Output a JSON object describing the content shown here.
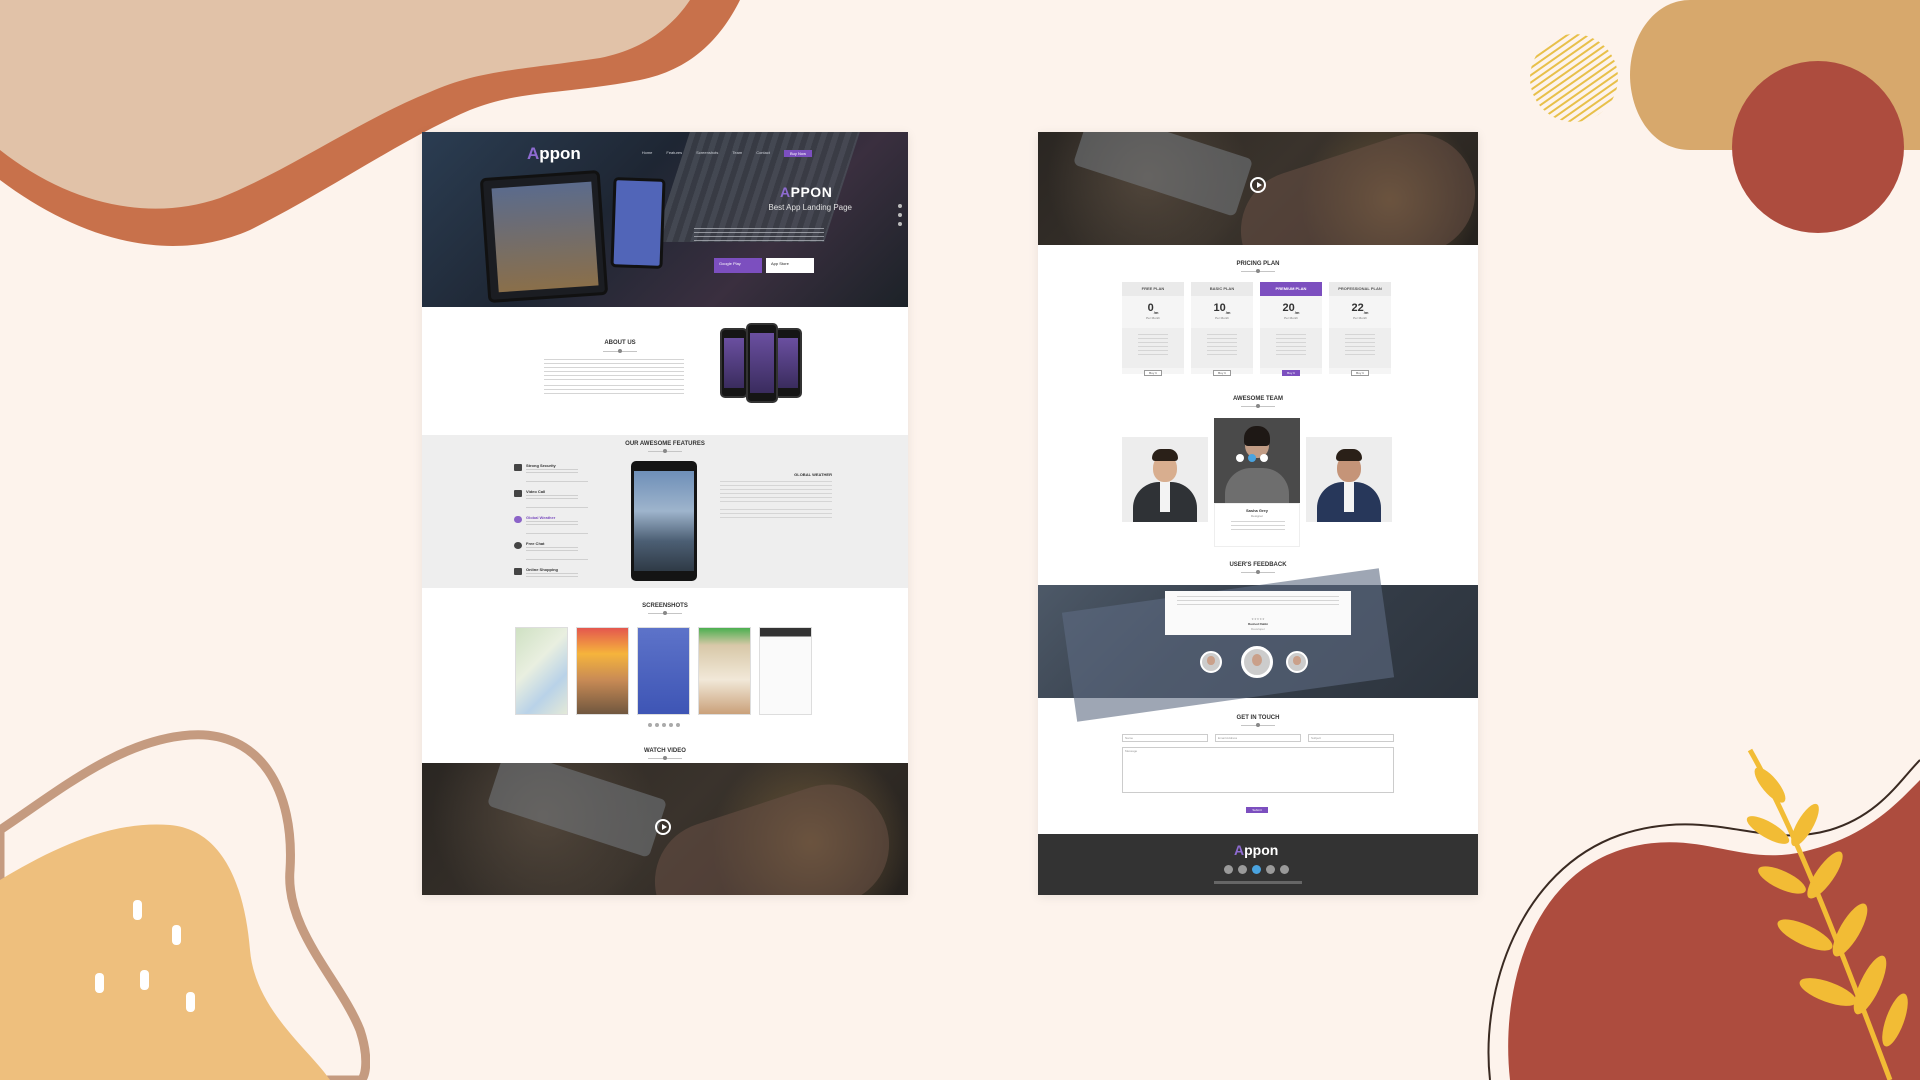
{
  "left": {
    "hero": {
      "logo": "ppon",
      "logo_accent": "A",
      "nav": [
        "Home",
        "Features",
        "Screenshots",
        "Team",
        "Contact"
      ],
      "buy": "Buy Now",
      "title_accent": "A",
      "title": "PPON",
      "subtitle": "Best App Landing Page",
      "google_play": "Google Play",
      "app_store": "App Store"
    },
    "about": {
      "title": "About Us"
    },
    "features": {
      "title": "Our Awesome Features",
      "items": [
        {
          "name": "Strong Security"
        },
        {
          "name": "Video Call"
        },
        {
          "name": "Global Weather"
        },
        {
          "name": "Free Chat"
        },
        {
          "name": "Online Shopping"
        }
      ],
      "right_title": "Global Weather"
    },
    "screenshots": {
      "title": "Screenshots"
    },
    "video": {
      "title": "Watch Video"
    }
  },
  "right": {
    "pricing": {
      "title": "Pricing Plan",
      "plans": [
        {
          "name": "Free Plan",
          "price": "0",
          "unit": "/m",
          "period": "Per Month",
          "button": "Buy It"
        },
        {
          "name": "Basic Plan",
          "price": "10",
          "unit": "/m",
          "period": "Per Month",
          "button": "Buy It"
        },
        {
          "name": "Premium Plan",
          "price": "20",
          "unit": "/m",
          "period": "Per Month",
          "button": "Buy It"
        },
        {
          "name": "Professional Plan",
          "price": "22",
          "unit": "/m",
          "period": "Per Month",
          "button": "Buy It"
        }
      ]
    },
    "team": {
      "title": "Awesome Team",
      "featured_name": "Sasha Grey",
      "featured_role": "Designer"
    },
    "feedback": {
      "title": "User's Feedback",
      "name": "Rashed Rabbi",
      "role": "Developer"
    },
    "contact": {
      "title": "Get In Touch",
      "name_ph": "Name",
      "email_ph": "Email Address",
      "subject_ph": "Subject",
      "message_ph": "Message",
      "submit": "Submit"
    },
    "footer": {
      "logo": "ppon",
      "logo_accent": "A"
    }
  },
  "colors": {
    "background": "#fdf3ec",
    "brand_purple": "#7c4fbf",
    "footer": "#333333",
    "deco_brown": "#c8714b",
    "deco_tan": "#d7a86c",
    "deco_red": "#ad4c3e",
    "deco_yellow": "#f2bc35"
  }
}
